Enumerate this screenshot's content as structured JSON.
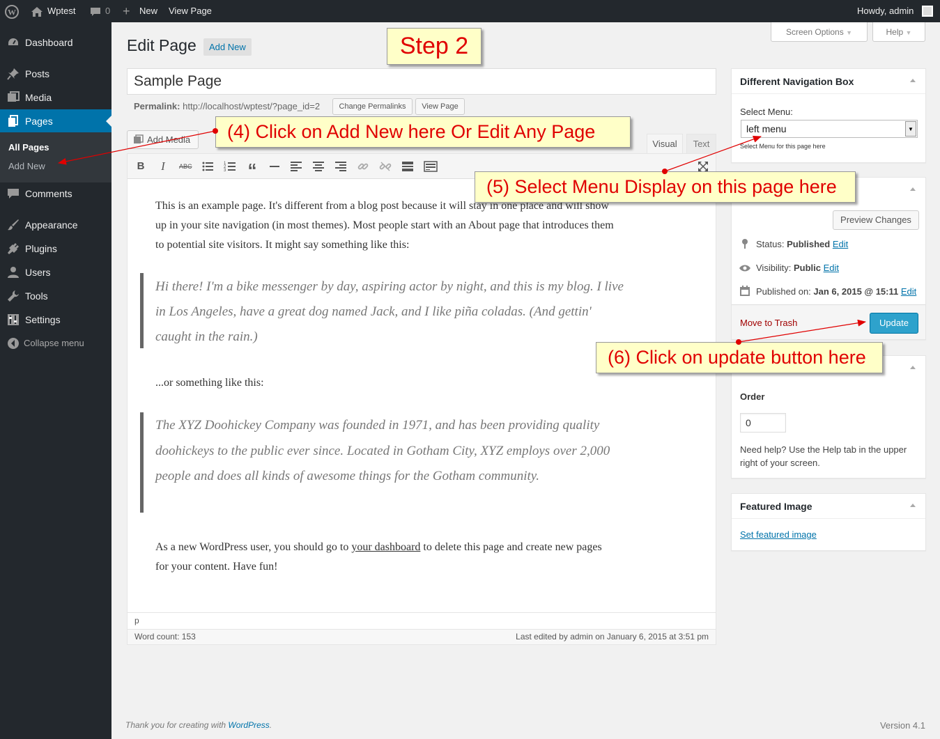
{
  "adminbar": {
    "site_name": "Wptest",
    "comments_count": "0",
    "new_label": "New",
    "view_page_label": "View Page",
    "howdy": "Howdy, admin"
  },
  "sidebar": {
    "items": [
      {
        "label": "Dashboard",
        "icon": "dashboard-icon"
      },
      {
        "label": "Posts",
        "icon": "pin-icon"
      },
      {
        "label": "Media",
        "icon": "media-icon"
      },
      {
        "label": "Pages",
        "icon": "pages-icon"
      },
      {
        "label": "Comments",
        "icon": "comment-icon"
      },
      {
        "label": "Appearance",
        "icon": "brush-icon"
      },
      {
        "label": "Plugins",
        "icon": "plug-icon"
      },
      {
        "label": "Users",
        "icon": "user-icon"
      },
      {
        "label": "Tools",
        "icon": "wrench-icon"
      },
      {
        "label": "Settings",
        "icon": "settings-icon"
      },
      {
        "label": "Collapse menu",
        "icon": "collapse-icon"
      }
    ],
    "submenu": [
      "All Pages",
      "Add New"
    ]
  },
  "header": {
    "title": "Edit Page",
    "add_new": "Add New",
    "screen_options": "Screen Options",
    "help": "Help"
  },
  "editor": {
    "title_value": "Sample Page",
    "permalink_label": "Permalink:",
    "permalink_url": "http://localhost/wptest/?page_id=2",
    "change_permalinks": "Change Permalinks",
    "view_page": "View Page",
    "add_media": "Add Media",
    "tab_visual": "Visual",
    "tab_text": "Text",
    "p1": "This is an example page. It's different from a blog post because it will stay in one place and will show up in your site navigation (in most themes). Most people start with an About page that introduces them to potential site visitors. It might say something like this:",
    "q1": "Hi there! I'm a bike messenger by day, aspiring actor by night, and this is my blog. I live in Los Angeles, have a great dog named Jack, and I like piña coladas. (And gettin' caught in the rain.)",
    "p2": "...or something like this:",
    "q2": "The XYZ Doohickey Company was founded in 1971, and has been providing quality doohickeys to the public ever since. Located in Gotham City, XYZ employs over 2,000 people and does all kinds of awesome things for the Gotham community.",
    "p3_before": "As a new WordPress user, you should go to ",
    "p3_link": "your dashboard",
    "p3_after": " to delete this page and create new pages for your content. Have fun!",
    "path": "p",
    "word_count": "Word count: 153",
    "last_edited": "Last edited by admin on January 6, 2015 at 3:51 pm"
  },
  "nav_box": {
    "title": "Different Navigation Box",
    "select_label": "Select Menu:",
    "selected": "left menu",
    "hint": "Select Menu for this page here"
  },
  "publish": {
    "preview": "Preview Changes",
    "status_label": "Status:",
    "status_value": "Published",
    "visibility_label": "Visibility:",
    "visibility_value": "Public",
    "published_label": "Published on:",
    "published_value": "Jan 6, 2015 @ 15:11",
    "edit": "Edit",
    "trash": "Move to Trash",
    "update": "Update"
  },
  "attributes": {
    "order_label": "Order",
    "order_value": "0",
    "help": "Need help? Use the Help tab in the upper right of your screen."
  },
  "featured": {
    "title": "Featured Image",
    "link": "Set featured image"
  },
  "footer": {
    "thanks": "Thank you for creating with ",
    "wp_link": "WordPress",
    "dot": ".",
    "version": "Version 4.1"
  },
  "callouts": {
    "step2": "Step 2",
    "c4": "(4) Click on Add New here Or Edit Any Page",
    "c5": "(5) Select Menu Display on this page here",
    "c6": "(6) Click on update button here"
  },
  "colors": {
    "admin_dark": "#23282d",
    "accent": "#0073aa",
    "update_button": "#2ea2cc",
    "callout_bg": "#ffffc8",
    "callout_text": "#e00000",
    "trash": "#a00000"
  }
}
